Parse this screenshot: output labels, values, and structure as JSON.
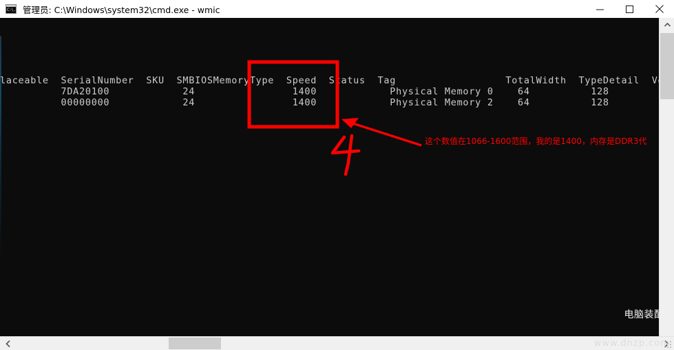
{
  "window": {
    "title": "管理员: C:\\Windows\\system32\\cmd.exe - wmic",
    "icon": "cmd-console-icon",
    "minimize_label": "—",
    "maximize_label": "□",
    "close_label": "✕"
  },
  "console": {
    "background": "#0C0C0C",
    "foreground": "#CCCCCC",
    "header_line": "laceable  SerialNumber  SKU  SMBIOSMemoryType  Speed  Status  Tag                  TotalWidth  TypeDetail  Version",
    "rows": [
      "          7DA20100            24                1400            Physical Memory 0    64          128",
      "          00000000            24                1400            Physical Memory 2    64          128"
    ],
    "columns": [
      "laceable",
      "SerialNumber",
      "SKU",
      "SMBIOSMemoryType",
      "Speed",
      "Status",
      "Tag",
      "TotalWidth",
      "TypeDetail",
      "Version"
    ],
    "table": [
      {
        "laceable": "",
        "SerialNumber": "7DA20100",
        "SKU": "",
        "SMBIOSMemoryType": "24",
        "Speed": "1400",
        "Status": "",
        "Tag": "Physical Memory 0",
        "TotalWidth": "64",
        "TypeDetail": "128",
        "Version": ""
      },
      {
        "laceable": "",
        "SerialNumber": "00000000",
        "SKU": "",
        "SMBIOSMemoryType": "24",
        "Speed": "1400",
        "Status": "",
        "Tag": "Physical Memory 2",
        "TotalWidth": "64",
        "TypeDetail": "128",
        "Version": ""
      }
    ]
  },
  "annotations": {
    "color": "#FF0000",
    "highlight_box_label": "speed-column-highlight",
    "step_number": "4",
    "note": "这个数值在1066-1600范围，我的是1400，内存是DDR3代"
  },
  "watermarks": {
    "primary": "电脑装配网",
    "secondary": "www.dnzp.com"
  },
  "scrollbars": {
    "vertical_up": "▲",
    "vertical_down": "▼",
    "horizontal_left": "❮",
    "horizontal_right": "❯"
  }
}
